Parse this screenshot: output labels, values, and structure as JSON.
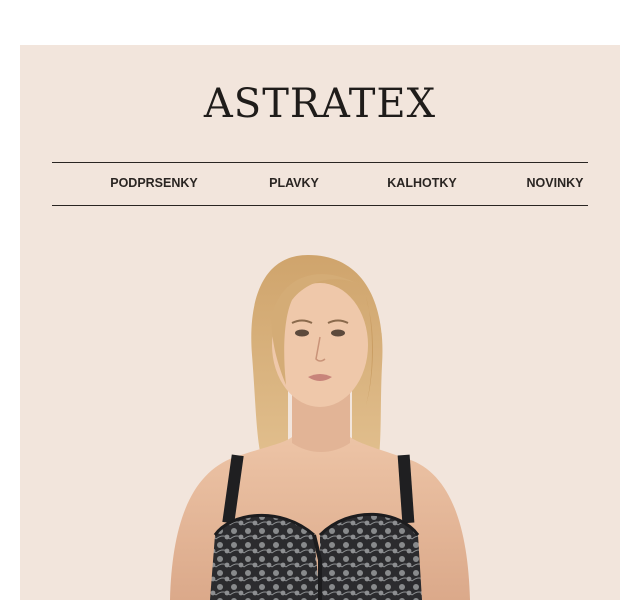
{
  "brand": {
    "logo_text": "ASTRATEX"
  },
  "nav": {
    "items": [
      {
        "label": "PODPRSENKY"
      },
      {
        "label": "PLAVKY"
      },
      {
        "label": "KALHOTKY"
      },
      {
        "label": "NOVINKY"
      }
    ]
  },
  "hero": {
    "image_subject": "model wearing black and silver lace bra",
    "colors": {
      "background": "#f2e5dc",
      "hair": "#d9b47f",
      "skin": "#e6b99a",
      "lace_dark": "#2b2b2e",
      "lace_light": "#a7a9ab"
    }
  },
  "theme": {
    "card_background": "#f2e5dc",
    "text_color": "#2a2522",
    "page_background": "#ffffff"
  }
}
